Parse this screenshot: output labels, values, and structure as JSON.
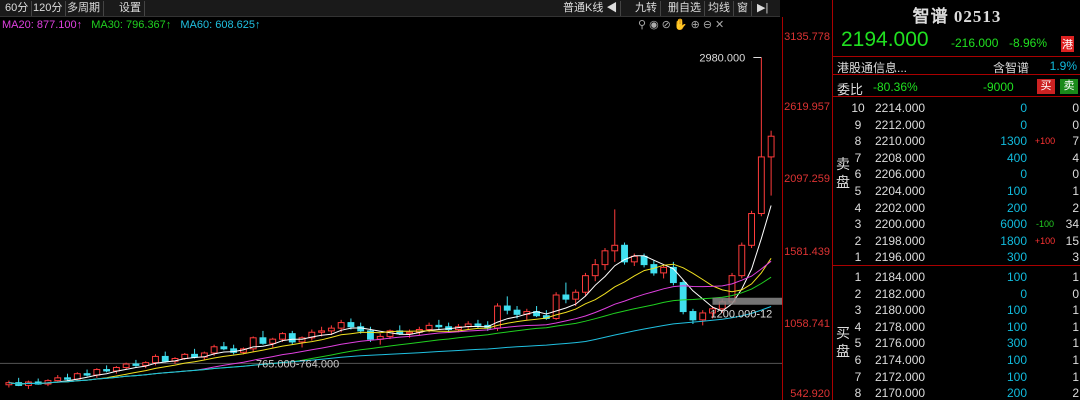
{
  "toolbar": {
    "left_buttons": [
      "60分",
      "120分",
      "多周期",
      "设置"
    ],
    "kline_type": "普通K线",
    "nine_turn": "九转",
    "self_select": "删自选",
    "ma_line": "均线",
    "window": "窗"
  },
  "ma_legend": [
    {
      "label": "MA20: 877.100↑",
      "color": "#e040e0"
    },
    {
      "label": "MA30: 796.367↑",
      "color": "#20d020"
    },
    {
      "label": "MA60: 608.625↑",
      "color": "#20c0e0"
    }
  ],
  "price_axis": [
    "3135.778",
    "2619.957",
    "2097.259",
    "1581.439",
    "1058.741",
    "542.920"
  ],
  "chart_data": {
    "type": "candlestick",
    "ylim": [
      542.92,
      3135.778
    ],
    "annotations": [
      "2980.000",
      "1200.000-12",
      "765.000-764.000"
    ],
    "candles": [
      [
        610,
        640,
        590,
        625
      ],
      [
        625,
        660,
        600,
        605
      ],
      [
        605,
        640,
        580,
        630
      ],
      [
        630,
        655,
        610,
        615
      ],
      [
        615,
        650,
        600,
        640
      ],
      [
        640,
        680,
        625,
        660
      ],
      [
        660,
        690,
        640,
        650
      ],
      [
        650,
        700,
        640,
        690
      ],
      [
        690,
        720,
        670,
        680
      ],
      [
        680,
        730,
        660,
        720
      ],
      [
        720,
        750,
        700,
        710
      ],
      [
        710,
        745,
        690,
        735
      ],
      [
        735,
        770,
        720,
        760
      ],
      [
        760,
        790,
        740,
        750
      ],
      [
        750,
        780,
        730,
        770
      ],
      [
        770,
        830,
        750,
        815
      ],
      [
        815,
        850,
        770,
        780
      ],
      [
        780,
        810,
        760,
        800
      ],
      [
        800,
        840,
        790,
        830
      ],
      [
        830,
        870,
        800,
        810
      ],
      [
        810,
        850,
        790,
        840
      ],
      [
        840,
        900,
        820,
        885
      ],
      [
        885,
        920,
        860,
        870
      ],
      [
        870,
        900,
        830,
        845
      ],
      [
        845,
        880,
        830,
        870
      ],
      [
        870,
        960,
        850,
        950
      ],
      [
        950,
        1000,
        900,
        910
      ],
      [
        910,
        950,
        880,
        940
      ],
      [
        940,
        990,
        920,
        980
      ],
      [
        980,
        1000,
        900,
        920
      ],
      [
        920,
        960,
        880,
        950
      ],
      [
        950,
        1010,
        930,
        990
      ],
      [
        990,
        1030,
        960,
        1000
      ],
      [
        1000,
        1040,
        970,
        1020
      ],
      [
        1020,
        1080,
        990,
        1060
      ],
      [
        1060,
        1090,
        1010,
        1030
      ],
      [
        1030,
        1060,
        980,
        1000
      ],
      [
        1000,
        1030,
        920,
        940
      ],
      [
        940,
        980,
        900,
        960
      ],
      [
        960,
        1010,
        940,
        1000
      ],
      [
        1000,
        1040,
        970,
        980
      ],
      [
        980,
        1010,
        950,
        990
      ],
      [
        990,
        1030,
        970,
        1010
      ],
      [
        1010,
        1060,
        990,
        1040
      ],
      [
        1040,
        1080,
        1010,
        1030
      ],
      [
        1030,
        1060,
        990,
        1010
      ],
      [
        1010,
        1050,
        990,
        1030
      ],
      [
        1030,
        1070,
        1010,
        1050
      ],
      [
        1050,
        1080,
        1020,
        1040
      ],
      [
        1040,
        1070,
        1000,
        1020
      ],
      [
        1020,
        1200,
        1000,
        1180
      ],
      [
        1180,
        1250,
        1120,
        1150
      ],
      [
        1150,
        1180,
        1090,
        1120
      ],
      [
        1120,
        1160,
        1080,
        1140
      ],
      [
        1140,
        1180,
        1100,
        1110
      ],
      [
        1110,
        1150,
        1080,
        1090
      ],
      [
        1090,
        1280,
        1080,
        1260
      ],
      [
        1260,
        1350,
        1200,
        1230
      ],
      [
        1230,
        1300,
        1180,
        1280
      ],
      [
        1280,
        1420,
        1250,
        1400
      ],
      [
        1400,
        1520,
        1360,
        1480
      ],
      [
        1480,
        1600,
        1440,
        1580
      ],
      [
        1580,
        1880,
        1500,
        1620
      ],
      [
        1620,
        1640,
        1480,
        1500
      ],
      [
        1500,
        1560,
        1470,
        1540
      ],
      [
        1540,
        1560,
        1460,
        1480
      ],
      [
        1480,
        1510,
        1400,
        1420
      ],
      [
        1420,
        1480,
        1380,
        1460
      ],
      [
        1460,
        1500,
        1330,
        1350
      ],
      [
        1350,
        1370,
        1120,
        1140
      ],
      [
        1140,
        1160,
        1050,
        1080
      ],
      [
        1080,
        1150,
        1040,
        1130
      ],
      [
        1130,
        1180,
        1090,
        1160
      ],
      [
        1160,
        1230,
        1130,
        1210
      ],
      [
        1210,
        1420,
        1190,
        1400
      ],
      [
        1400,
        1640,
        1380,
        1620
      ],
      [
        1620,
        1870,
        1600,
        1850
      ],
      [
        1850,
        2980,
        1830,
        2260
      ],
      [
        2260,
        2450,
        1980,
        2410
      ]
    ]
  },
  "panel": {
    "title": "智谱 02513",
    "price": "2194.000",
    "change": "-216.000",
    "change_pct": "-8.96%",
    "hk_badge": "港",
    "info_left": "港股通信息...",
    "info_mid": "含智谱",
    "info_right": "1.9%",
    "weibi_label": "委比",
    "weibi_pct": "-80.36%",
    "weibi_diff": "-9000",
    "buy_btn": "买",
    "sell_btn": "卖",
    "sell_label": "卖盘",
    "buy_label": "买盘",
    "sell_rows": [
      {
        "lv": "10",
        "price": "2214.000",
        "vol": "0",
        "chg": "",
        "cnt": "0"
      },
      {
        "lv": "9",
        "price": "2212.000",
        "vol": "0",
        "chg": "",
        "cnt": "0"
      },
      {
        "lv": "8",
        "price": "2210.000",
        "vol": "1300",
        "chg": "+100",
        "cnt": "7"
      },
      {
        "lv": "7",
        "price": "2208.000",
        "vol": "400",
        "chg": "",
        "cnt": "4"
      },
      {
        "lv": "6",
        "price": "2206.000",
        "vol": "0",
        "chg": "",
        "cnt": "0"
      },
      {
        "lv": "5",
        "price": "2204.000",
        "vol": "100",
        "chg": "",
        "cnt": "1"
      },
      {
        "lv": "4",
        "price": "2202.000",
        "vol": "200",
        "chg": "",
        "cnt": "2"
      },
      {
        "lv": "3",
        "price": "2200.000",
        "vol": "6000",
        "chg": "-100",
        "cnt": "34"
      },
      {
        "lv": "2",
        "price": "2198.000",
        "vol": "1800",
        "chg": "+100",
        "cnt": "15"
      },
      {
        "lv": "1",
        "price": "2196.000",
        "vol": "300",
        "chg": "",
        "cnt": "3"
      }
    ],
    "buy_rows": [
      {
        "lv": "1",
        "price": "2184.000",
        "vol": "100",
        "chg": "",
        "cnt": "1"
      },
      {
        "lv": "2",
        "price": "2182.000",
        "vol": "0",
        "chg": "",
        "cnt": "0"
      },
      {
        "lv": "3",
        "price": "2180.000",
        "vol": "100",
        "chg": "",
        "cnt": "1"
      },
      {
        "lv": "4",
        "price": "2178.000",
        "vol": "100",
        "chg": "",
        "cnt": "1"
      },
      {
        "lv": "5",
        "price": "2176.000",
        "vol": "300",
        "chg": "",
        "cnt": "1"
      },
      {
        "lv": "6",
        "price": "2174.000",
        "vol": "100",
        "chg": "",
        "cnt": "1"
      },
      {
        "lv": "7",
        "price": "2172.000",
        "vol": "100",
        "chg": "",
        "cnt": "1"
      },
      {
        "lv": "8",
        "price": "2170.000",
        "vol": "200",
        "chg": "",
        "cnt": "2"
      }
    ]
  }
}
